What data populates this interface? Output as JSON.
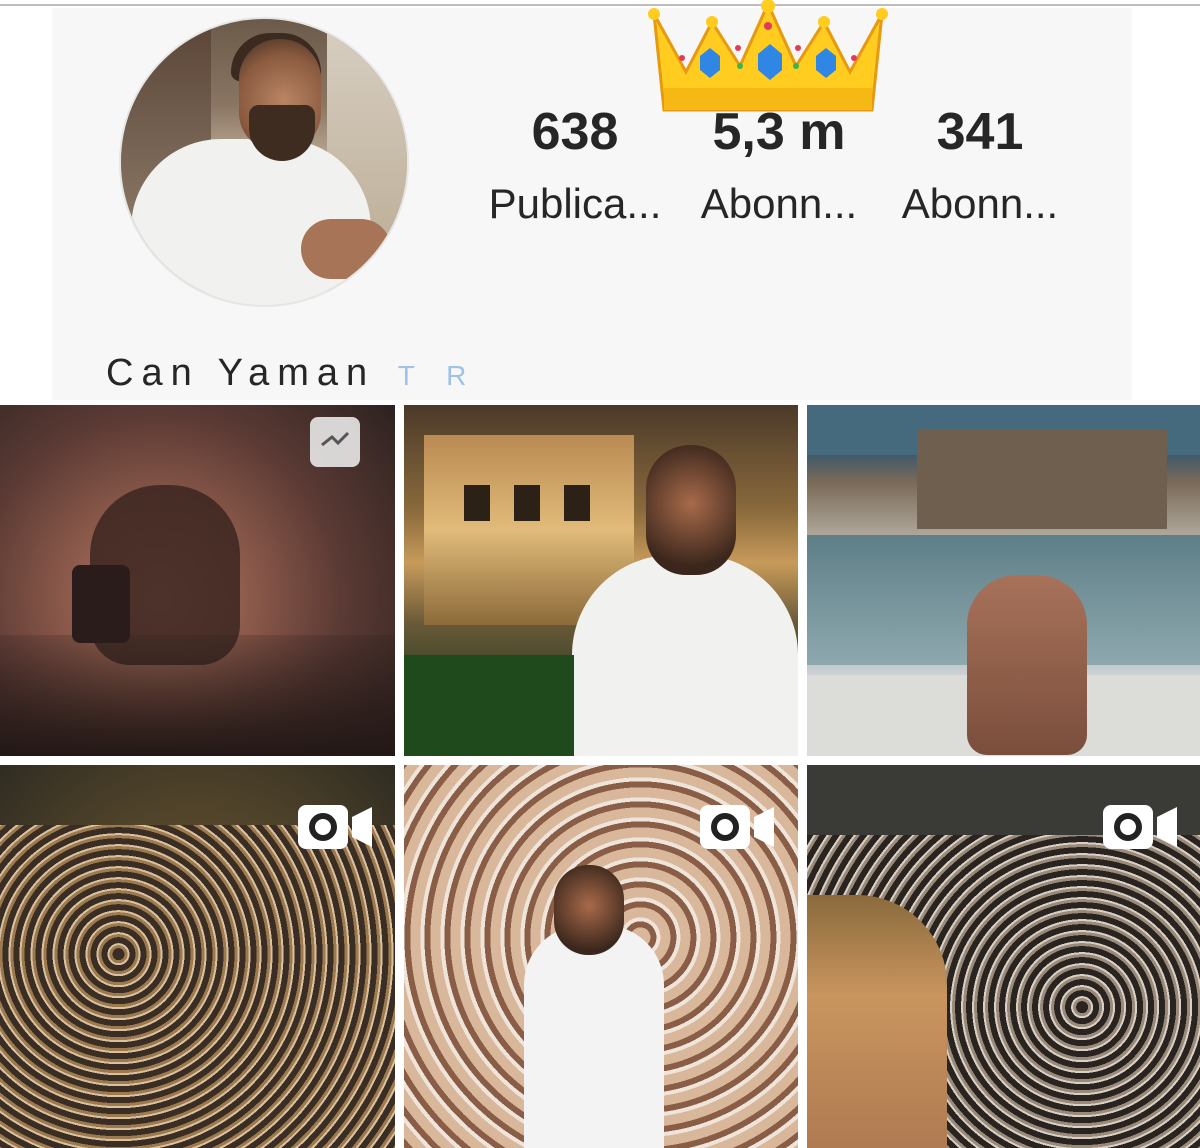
{
  "profile": {
    "name": "Can Yaman",
    "name_tag": "T R",
    "stats": [
      {
        "value": "638",
        "label": "Publica..."
      },
      {
        "value": "5,3 m",
        "label": "Abonn..."
      },
      {
        "value": "341",
        "label": "Abonn..."
      }
    ]
  },
  "decorations": {
    "crown": "crown-emoji"
  },
  "grid": [
    {
      "type": "multi-photo",
      "icon": "multi-photo-icon"
    },
    {
      "type": "photo"
    },
    {
      "type": "photo"
    },
    {
      "type": "video",
      "icon": "video-icon"
    },
    {
      "type": "video",
      "icon": "video-icon"
    },
    {
      "type": "video",
      "icon": "video-icon"
    }
  ],
  "colors": {
    "text": "#262626",
    "panel_bg": "#f7f7f7",
    "tag_color": "#9ec3e6"
  }
}
